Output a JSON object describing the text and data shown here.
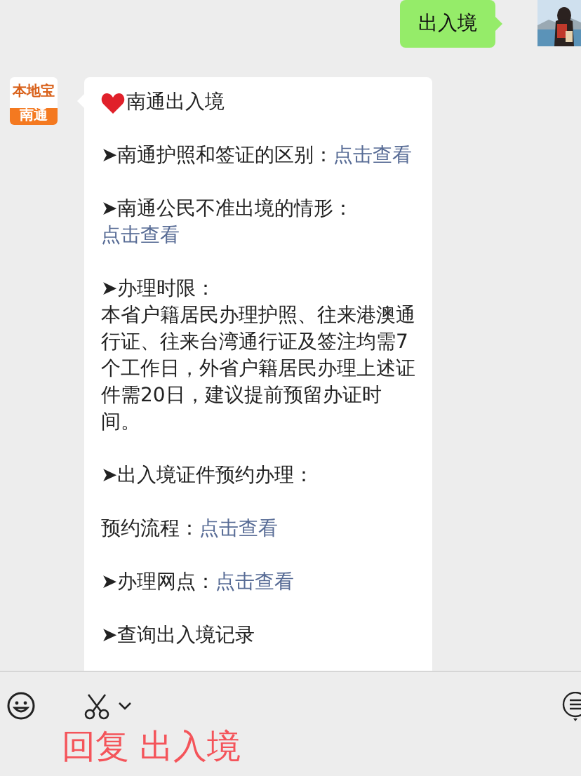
{
  "sent_message": {
    "text": "出入境"
  },
  "received_message": {
    "sender_logo": {
      "top": "本地宝",
      "bottom": "南通"
    },
    "title": "南通出入境",
    "paragraphs": [
      {
        "lines": [
          [
            {
              "kind": "text",
              "text": "➤南通护照和签证的区别："
            },
            {
              "kind": "link",
              "text": "点击查看"
            }
          ]
        ]
      },
      {
        "lines": [
          [
            {
              "kind": "text",
              "text": "➤南通公民不准出境的情形："
            }
          ],
          [
            {
              "kind": "link",
              "text": "点击查看"
            }
          ]
        ]
      },
      {
        "lines": [
          [
            {
              "kind": "text",
              "text": "➤办理时限："
            }
          ],
          [
            {
              "kind": "text",
              "text": "本省户籍居民办理护照、往来港澳通"
            }
          ],
          [
            {
              "kind": "text",
              "text": "行证、往来台湾通行证及签注均需7"
            }
          ],
          [
            {
              "kind": "text",
              "text": "个工作日，外省户籍居民办理上述证"
            }
          ],
          [
            {
              "kind": "text",
              "text": "件需20日，建议提前预留办证时"
            }
          ],
          [
            {
              "kind": "text",
              "text": "间。"
            }
          ]
        ]
      },
      {
        "lines": [
          [
            {
              "kind": "text",
              "text": "➤出入境证件预约办理："
            }
          ]
        ]
      },
      {
        "lines": [
          [
            {
              "kind": "text",
              "text": "预约流程："
            },
            {
              "kind": "link",
              "text": "点击查看"
            }
          ]
        ]
      },
      {
        "lines": [
          [
            {
              "kind": "text",
              "text": "➤办理网点："
            },
            {
              "kind": "link",
              "text": "点击查看"
            }
          ]
        ]
      },
      {
        "lines": [
          [
            {
              "kind": "text",
              "text": "➤查询出入境记录"
            }
          ]
        ]
      }
    ]
  },
  "reply_caption": "回复 出入境"
}
